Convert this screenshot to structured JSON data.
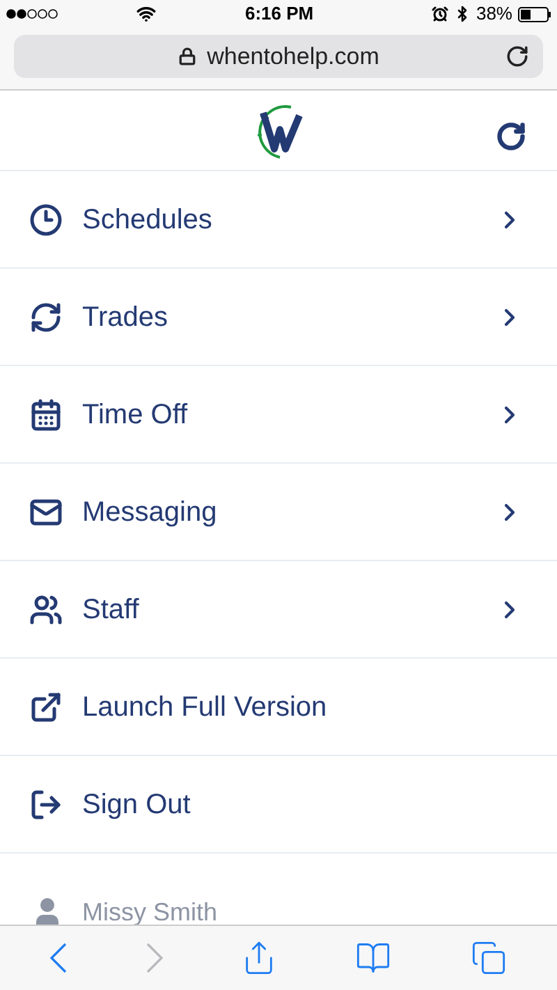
{
  "status_bar": {
    "time": "6:16 PM",
    "battery": "38%"
  },
  "address_bar": {
    "url": "whentohelp.com"
  },
  "menu": [
    {
      "kind": "nav",
      "label": "Schedules"
    },
    {
      "kind": "nav",
      "label": "Trades"
    },
    {
      "kind": "nav",
      "label": "Time Off"
    },
    {
      "kind": "nav",
      "label": "Messaging"
    },
    {
      "kind": "nav",
      "label": "Staff"
    },
    {
      "kind": "action",
      "label": "Launch Full Version"
    },
    {
      "kind": "action",
      "label": "Sign Out"
    },
    {
      "kind": "user",
      "label": "Missy Smith"
    }
  ],
  "toolbar": [
    {
      "disabled": false
    },
    {
      "disabled": true
    },
    {
      "disabled": false
    },
    {
      "disabled": false
    },
    {
      "disabled": false
    }
  ]
}
